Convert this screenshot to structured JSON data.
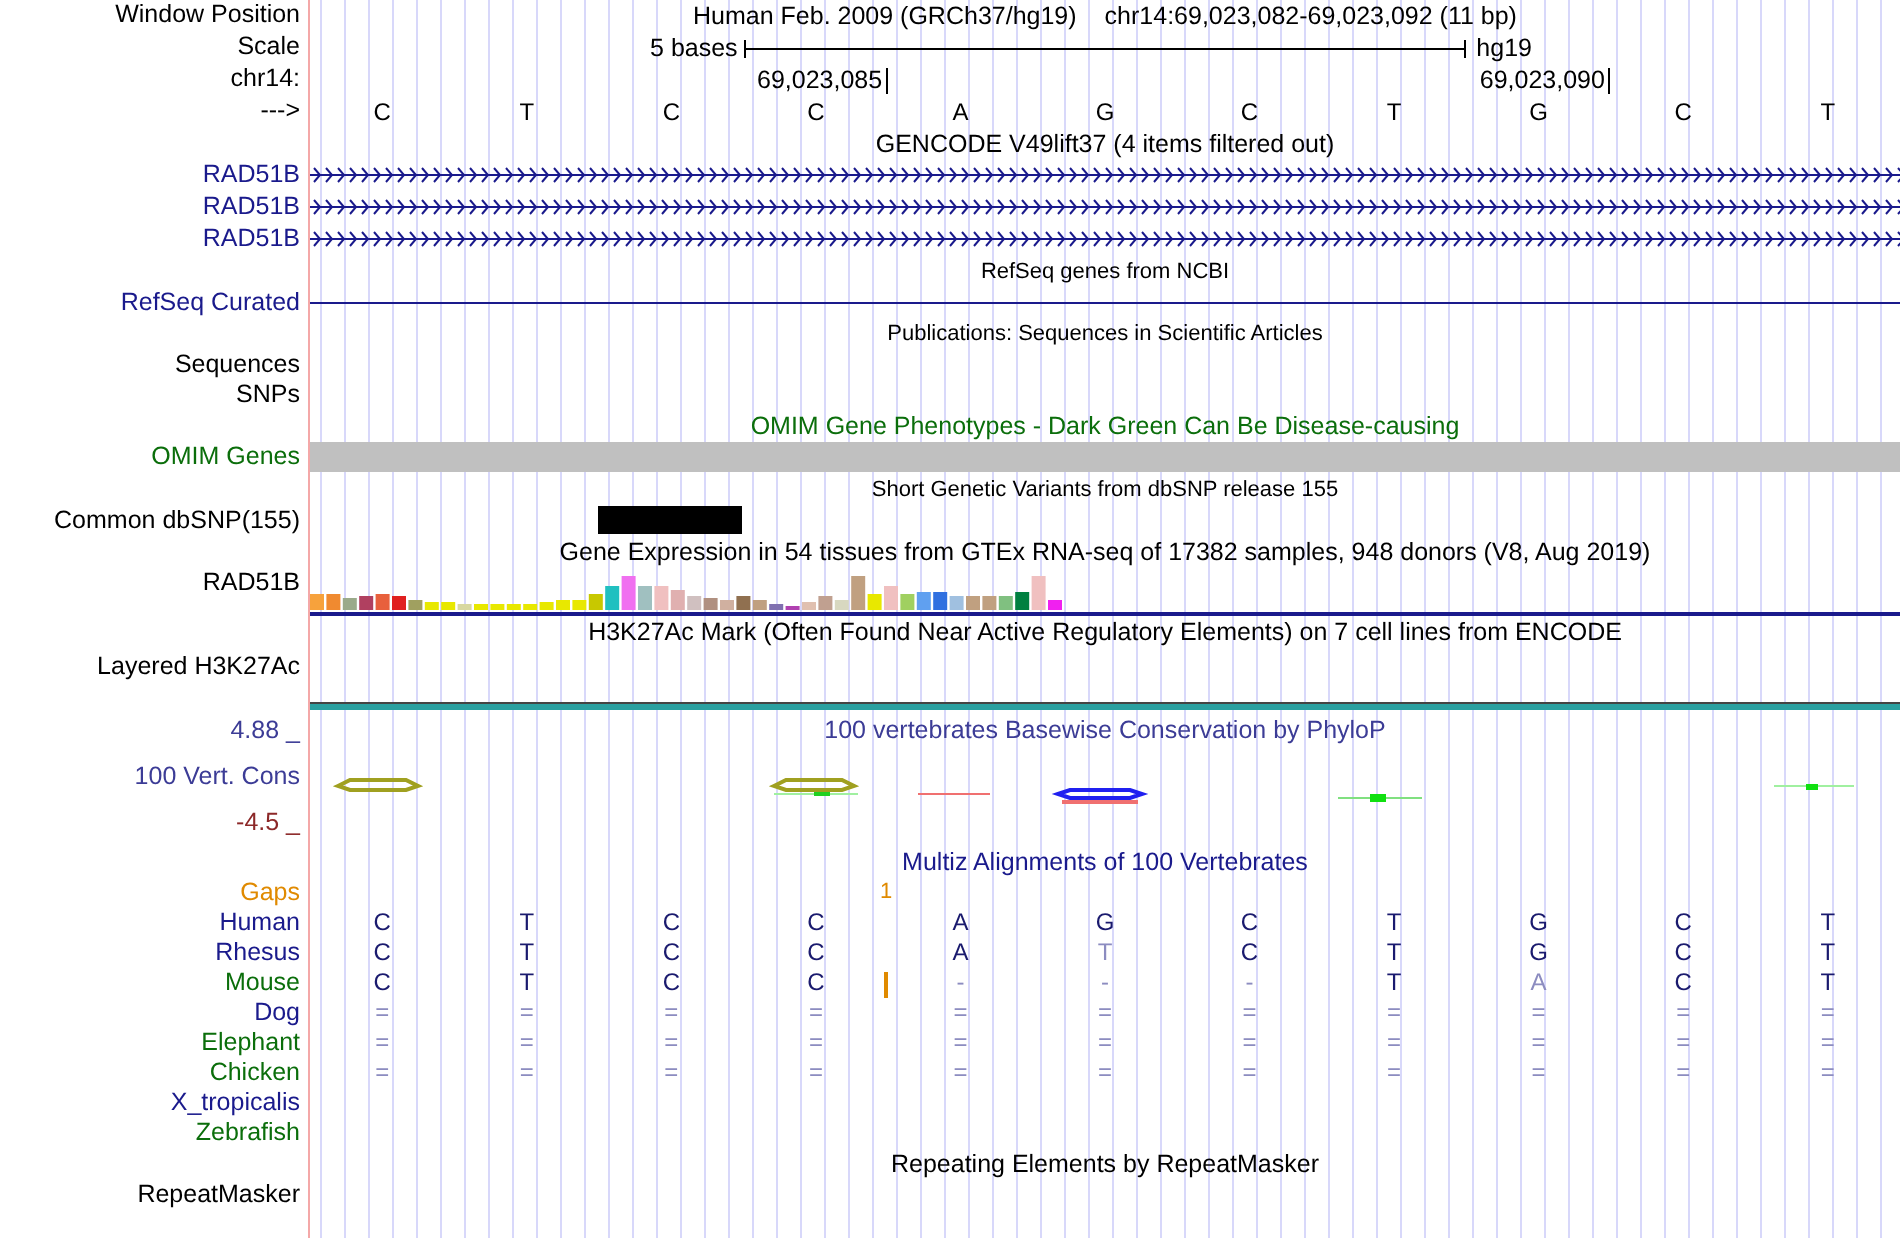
{
  "header": {
    "position_label": "Window Position",
    "assembly_title": "Human Feb. 2009 (GRCh37/hg19)",
    "position": "chr14:69,023,082-69,023,092 (11 bp)",
    "scale_label": "Scale",
    "scale_text": "5 bases",
    "assembly": "hg19",
    "chrom_label": "chr14:",
    "ticks": [
      "69,023,085",
      "69,023,090"
    ],
    "strand_label": "--->",
    "bases": [
      "C",
      "T",
      "C",
      "C",
      "A",
      "G",
      "C",
      "T",
      "G",
      "C",
      "T"
    ]
  },
  "tracks": [
    {
      "kind": "title",
      "text": "GENCODE V49lift37 (4 items filtered out)",
      "color": "#000000"
    },
    {
      "kind": "gene",
      "label": "RAD51B",
      "color": "#1a1a8c"
    },
    {
      "kind": "gene",
      "label": "RAD51B",
      "color": "#1a1a8c"
    },
    {
      "kind": "gene",
      "label": "RAD51B",
      "color": "#1a1a8c"
    },
    {
      "kind": "small_title",
      "text": "RefSeq genes from NCBI",
      "color": "#000000"
    },
    {
      "kind": "line",
      "label": "RefSeq Curated",
      "color": "#1a1a8c"
    },
    {
      "kind": "small_title",
      "text": "Publications: Sequences in Scientific Articles",
      "color": "#000000"
    },
    {
      "kind": "empty",
      "label": "Sequences",
      "color": "#000000"
    },
    {
      "kind": "empty",
      "label": "SNPs",
      "color": "#000000"
    },
    {
      "kind": "title",
      "text": "OMIM Gene Phenotypes - Dark Green Can Be Disease-causing",
      "color": "#0b6e0b"
    },
    {
      "kind": "bar",
      "label": "OMIM Genes",
      "color": "#0b6e0b"
    },
    {
      "kind": "small_title",
      "text": "Short Genetic Variants from dbSNP release 155",
      "color": "#000000"
    },
    {
      "kind": "variant",
      "label": "Common dbSNP(155)",
      "color": "#000000"
    },
    {
      "kind": "title",
      "text": "Gene Expression in 54 tissues from GTEx RNA-seq of 17382 samples, 948 donors (V8, Aug 2019)",
      "color": "#000000"
    },
    {
      "kind": "expression",
      "label": "RAD51B",
      "color": "#000000"
    },
    {
      "kind": "title",
      "text": "H3K27Ac Mark (Often Found Near Active Regulatory Elements) on 7 cell lines from ENCODE",
      "color": "#000000"
    },
    {
      "kind": "layered",
      "label": "Layered H3K27Ac",
      "color": "#000000"
    },
    {
      "kind": "wiggle",
      "title": "100 vertebrates Basewise Conservation by PhyloP",
      "label": "100 Vert. Cons",
      "top": "4.88 _",
      "bottom": "-4.5 _",
      "color": "#3c3c96"
    },
    {
      "kind": "title",
      "text": "Multiz Alignments of 100 Vertebrates",
      "color": "#1a1a8c"
    },
    {
      "kind": "gaps",
      "label": "Gaps",
      "mark": "1",
      "color": "#e08a00"
    },
    {
      "kind": "alignment",
      "label": "Human",
      "color": "#1a1a8c",
      "insertion": false,
      "bases": [
        {
          "base": "C",
          "differs": false
        },
        {
          "base": "T",
          "differs": false
        },
        {
          "base": "C",
          "differs": false
        },
        {
          "base": "C",
          "differs": false
        },
        {
          "base": "A",
          "differs": false
        },
        {
          "base": "G",
          "differs": false
        },
        {
          "base": "C",
          "differs": false
        },
        {
          "base": "T",
          "differs": false
        },
        {
          "base": "G",
          "differs": false
        },
        {
          "base": "C",
          "differs": false
        },
        {
          "base": "T",
          "differs": false
        }
      ]
    },
    {
      "kind": "alignment",
      "label": "Rhesus",
      "color": "#1a1a8c",
      "insertion": false,
      "bases": [
        {
          "base": "C",
          "differs": false
        },
        {
          "base": "T",
          "differs": false
        },
        {
          "base": "C",
          "differs": false
        },
        {
          "base": "C",
          "differs": false
        },
        {
          "base": "A",
          "differs": false
        },
        {
          "base": "T",
          "differs": true
        },
        {
          "base": "C",
          "differs": false
        },
        {
          "base": "T",
          "differs": false
        },
        {
          "base": "G",
          "differs": false
        },
        {
          "base": "C",
          "differs": false
        },
        {
          "base": "T",
          "differs": false
        }
      ]
    },
    {
      "kind": "alignment",
      "label": "Mouse",
      "color": "#0b6e0b",
      "insertion": true,
      "bases": [
        {
          "base": "C",
          "differs": false
        },
        {
          "base": "T",
          "differs": false
        },
        {
          "base": "C",
          "differs": false
        },
        {
          "base": "C",
          "differs": false
        },
        {
          "base": "-",
          "differs": true
        },
        {
          "base": "-",
          "differs": true
        },
        {
          "base": "-",
          "differs": true
        },
        {
          "base": "T",
          "differs": false
        },
        {
          "base": "A",
          "differs": true
        },
        {
          "base": "C",
          "differs": false
        },
        {
          "base": "T",
          "differs": false
        }
      ]
    },
    {
      "kind": "alignment",
      "label": "Dog",
      "color": "#1a1a8c",
      "insertion": false,
      "bases": [
        {
          "base": "=",
          "differs": true
        },
        {
          "base": "=",
          "differs": true
        },
        {
          "base": "=",
          "differs": true
        },
        {
          "base": "=",
          "differs": true
        },
        {
          "base": "=",
          "differs": true
        },
        {
          "base": "=",
          "differs": true
        },
        {
          "base": "=",
          "differs": true
        },
        {
          "base": "=",
          "differs": true
        },
        {
          "base": "=",
          "differs": true
        },
        {
          "base": "=",
          "differs": true
        },
        {
          "base": "=",
          "differs": true
        }
      ]
    },
    {
      "kind": "alignment",
      "label": "Elephant",
      "color": "#0b6e0b",
      "insertion": false,
      "bases": [
        {
          "base": "=",
          "differs": true
        },
        {
          "base": "=",
          "differs": true
        },
        {
          "base": "=",
          "differs": true
        },
        {
          "base": "=",
          "differs": true
        },
        {
          "base": "=",
          "differs": true
        },
        {
          "base": "=",
          "differs": true
        },
        {
          "base": "=",
          "differs": true
        },
        {
          "base": "=",
          "differs": true
        },
        {
          "base": "=",
          "differs": true
        },
        {
          "base": "=",
          "differs": true
        },
        {
          "base": "=",
          "differs": true
        }
      ]
    },
    {
      "kind": "alignment",
      "label": "Chicken",
      "color": "#0b6e0b",
      "insertion": false,
      "bases": [
        {
          "base": "=",
          "differs": true
        },
        {
          "base": "=",
          "differs": true
        },
        {
          "base": "=",
          "differs": true
        },
        {
          "base": "=",
          "differs": true
        },
        {
          "base": "=",
          "differs": true
        },
        {
          "base": "=",
          "differs": true
        },
        {
          "base": "=",
          "differs": true
        },
        {
          "base": "=",
          "differs": true
        },
        {
          "base": "=",
          "differs": true
        },
        {
          "base": "=",
          "differs": true
        },
        {
          "base": "=",
          "differs": true
        }
      ]
    },
    {
      "kind": "empty",
      "label": "X_tropicalis",
      "color": "#1a1a8c"
    },
    {
      "kind": "empty",
      "label": "Zebrafish",
      "color": "#0b6e0b"
    },
    {
      "kind": "title",
      "text": "Repeating Elements by RepeatMasker",
      "color": "#000000"
    },
    {
      "kind": "empty",
      "label": "RepeatMasker",
      "color": "#000000"
    }
  ]
}
